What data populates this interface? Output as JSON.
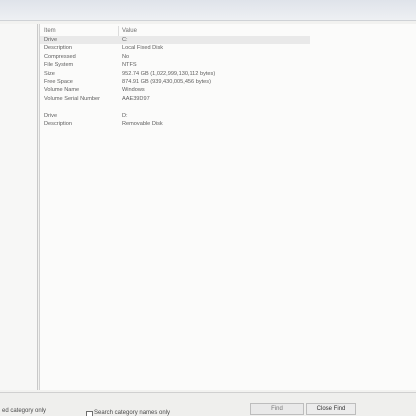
{
  "columns": {
    "item": "Item",
    "value": "Value"
  },
  "rows": [
    {
      "item": "Drive",
      "value": "C:",
      "selected": true
    },
    {
      "item": "Description",
      "value": "Local Fixed Disk"
    },
    {
      "item": "Compressed",
      "value": "No"
    },
    {
      "item": "File System",
      "value": "NTFS"
    },
    {
      "item": "Size",
      "value": "952.74 GB (1,022,999,130,112 bytes)"
    },
    {
      "item": "Free Space",
      "value": "874.91 GB (939,430,005,456 bytes)"
    },
    {
      "item": "Volume Name",
      "value": "Windows"
    },
    {
      "item": "Volume Serial Number",
      "value": "AAE39D97"
    },
    {
      "item": "",
      "value": ""
    },
    {
      "item": "Drive",
      "value": "D:"
    },
    {
      "item": "Description",
      "value": "Removable Disk"
    }
  ],
  "bottom": {
    "left_text": "ed category only",
    "search_checkbox_label": "Search category names only",
    "find_button": "Find",
    "close_find_button": "Close Find"
  }
}
